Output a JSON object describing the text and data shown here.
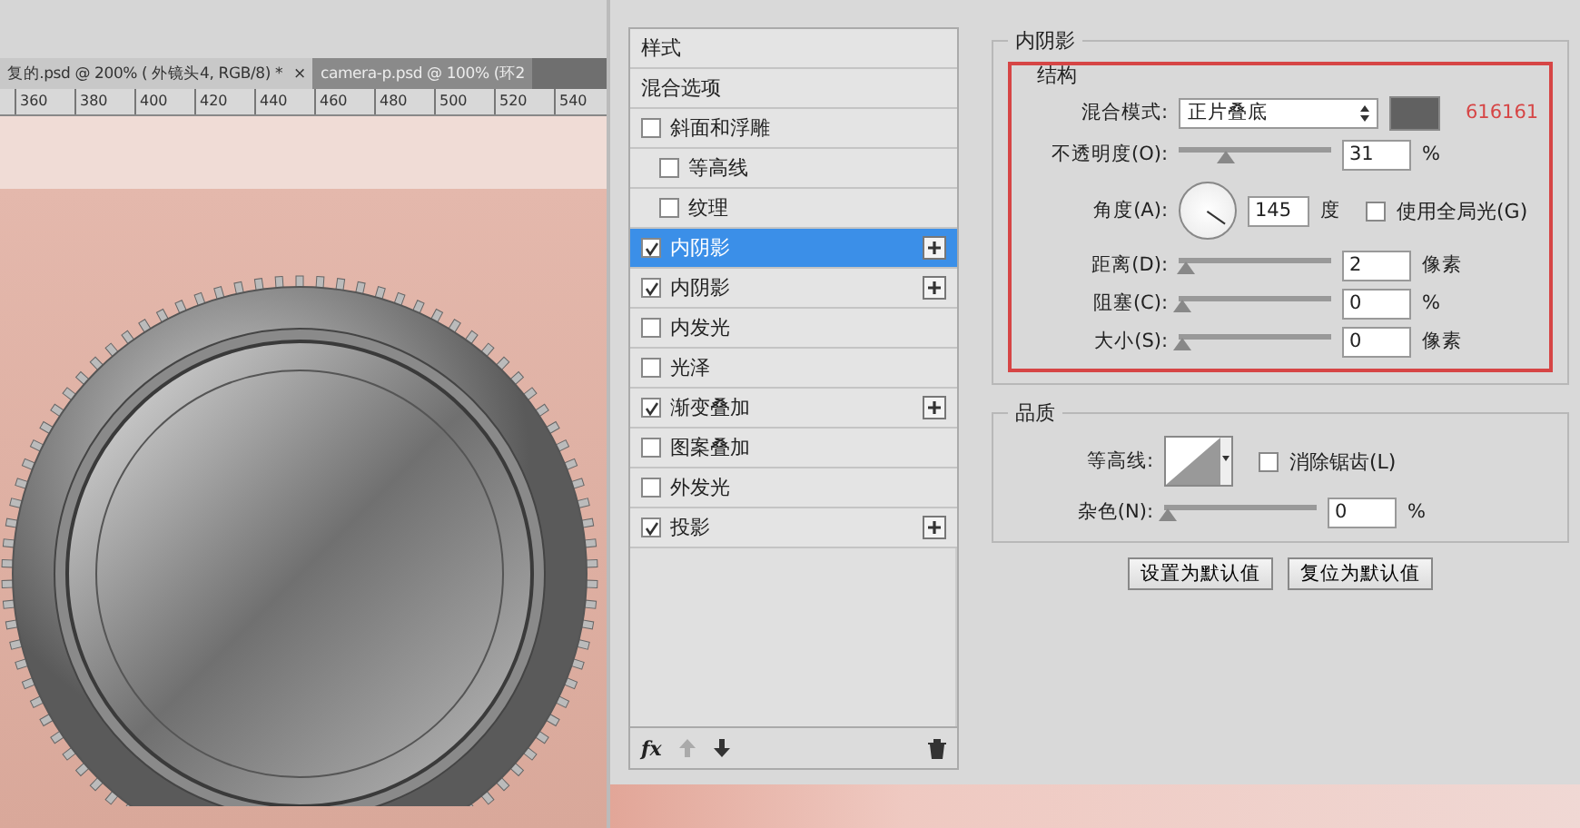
{
  "document_tabs": [
    {
      "label": "复的.psd @ 200% ( 外镜头4, RGB/8) *",
      "close": "×",
      "selected": true
    },
    {
      "label": "camera-p.psd @ 100% (环2",
      "selected": false
    }
  ],
  "ruler": [
    "360",
    "380",
    "400",
    "420",
    "440",
    "460",
    "480",
    "500",
    "520",
    "540"
  ],
  "style_list": [
    {
      "kind": "header",
      "label": "样式",
      "selected": false
    },
    {
      "kind": "plain",
      "label": "混合选项",
      "selected": false
    },
    {
      "kind": "check",
      "label": "斜面和浮雕",
      "checked": false,
      "addable": false,
      "selected": false,
      "children": [
        {
          "kind": "check",
          "label": "等高线",
          "checked": false,
          "addable": false,
          "selected": false
        },
        {
          "kind": "check",
          "label": "纹理",
          "checked": false,
          "addable": false,
          "selected": false
        }
      ]
    },
    {
      "kind": "check",
      "label": "内阴影",
      "checked": true,
      "addable": true,
      "selected": true
    },
    {
      "kind": "check",
      "label": "内阴影",
      "checked": true,
      "addable": true,
      "selected": false
    },
    {
      "kind": "check",
      "label": "内发光",
      "checked": false,
      "addable": false,
      "selected": false
    },
    {
      "kind": "check",
      "label": "光泽",
      "checked": false,
      "addable": false,
      "selected": false
    },
    {
      "kind": "check",
      "label": "渐变叠加",
      "checked": true,
      "addable": true,
      "selected": false
    },
    {
      "kind": "check",
      "label": "图案叠加",
      "checked": false,
      "addable": false,
      "selected": false
    },
    {
      "kind": "check",
      "label": "外发光",
      "checked": false,
      "addable": false,
      "selected": false
    },
    {
      "kind": "check",
      "label": "投影",
      "checked": true,
      "addable": true,
      "selected": false
    }
  ],
  "list_toolbar": {
    "fx": "fx"
  },
  "inner_shadow": {
    "title": "内阴影",
    "structure": {
      "title": "结构",
      "blend_mode": {
        "label": "混合模式:",
        "value": "正片叠底",
        "color": "#616161",
        "note": "616161"
      },
      "opacity": {
        "label": "不透明度(O):",
        "level": 0.3,
        "value": "31",
        "unit": "%"
      },
      "angle": {
        "label": "角度(A):",
        "value": "145",
        "unit": "度",
        "global_light": {
          "label": "使用全局光(G)",
          "checked": false
        }
      },
      "sliders": [
        {
          "label": "距离(D):",
          "level": 0.02,
          "value": "2",
          "unit": "像素"
        },
        {
          "label": "阻塞(C):",
          "level": 0,
          "value": "0",
          "unit": "%"
        },
        {
          "label": "大小(S):",
          "level": 0,
          "value": "0",
          "unit": "像素"
        }
      ]
    },
    "quality": {
      "title": "品质",
      "contour": {
        "label": "等高线:"
      },
      "anti_alias": {
        "label": "消除锯齿(L)",
        "checked": false
      },
      "noise": {
        "label": "杂色(N):",
        "level": 0,
        "value": "0",
        "unit": "%"
      }
    },
    "buttons": [
      "设置为默认值",
      "复位为默认值"
    ]
  }
}
